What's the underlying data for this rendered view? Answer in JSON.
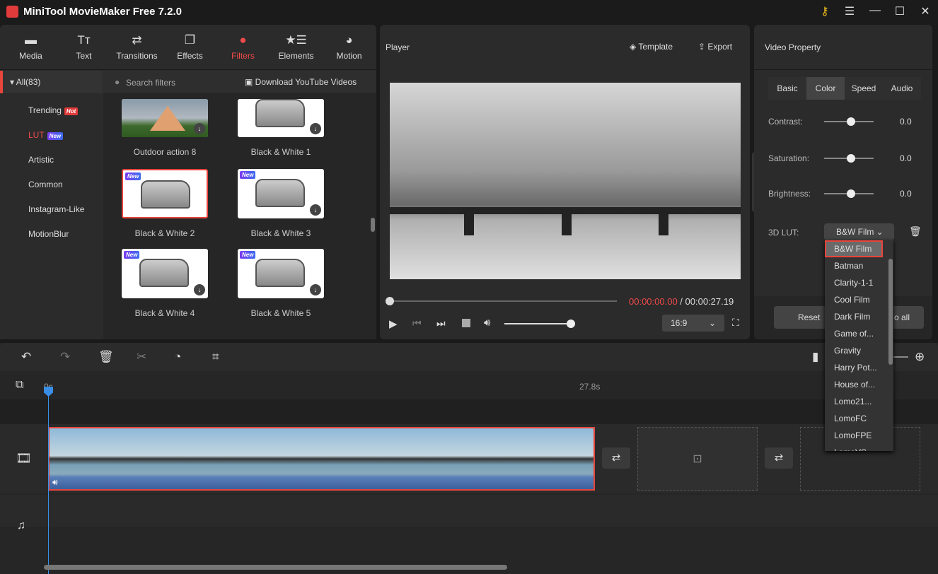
{
  "app": {
    "title": "MiniTool MovieMaker Free 7.2.0"
  },
  "toolbar": [
    {
      "label": "Media",
      "icon": "folder-icon"
    },
    {
      "label": "Text",
      "icon": "text-icon"
    },
    {
      "label": "Transitions",
      "icon": "transitions-icon"
    },
    {
      "label": "Effects",
      "icon": "effects-icon"
    },
    {
      "label": "Filters",
      "icon": "filters-icon"
    },
    {
      "label": "Elements",
      "icon": "elements-icon"
    },
    {
      "label": "Motion",
      "icon": "motion-icon"
    }
  ],
  "sidebar": {
    "all": "All(83)",
    "items": [
      {
        "label": "Trending",
        "badge": "Hot"
      },
      {
        "label": "LUT",
        "badge": "New"
      },
      {
        "label": "Artistic"
      },
      {
        "label": "Common"
      },
      {
        "label": "Instagram-Like"
      },
      {
        "label": "MotionBlur"
      }
    ]
  },
  "search": {
    "placeholder": "Search filters",
    "download": "Download YouTube Videos"
  },
  "filters": [
    {
      "name": "Outdoor action 8"
    },
    {
      "name": "Black & White 1"
    },
    {
      "name": "Black & White 2",
      "badge": "New",
      "selected": true
    },
    {
      "name": "Black & White 3",
      "badge": "New"
    },
    {
      "name": "Black & White 4",
      "badge": "New"
    },
    {
      "name": "Black & White 5",
      "badge": "New"
    }
  ],
  "player": {
    "title": "Player",
    "template": "Template",
    "export": "Export",
    "current_time": "00:00:00.00",
    "separator": " / ",
    "total_time": "00:00:27.19",
    "aspect": "16:9",
    "progress": 0,
    "volume": 1.0
  },
  "property": {
    "title": "Video Property",
    "tabs": [
      "Basic",
      "Color",
      "Speed",
      "Audio"
    ],
    "active_tab": "Color",
    "sliders": [
      {
        "label": "Contrast:",
        "value": "0.0"
      },
      {
        "label": "Saturation:",
        "value": "0.0"
      },
      {
        "label": "Brightness:",
        "value": "0.0"
      }
    ],
    "lut_label": "3D LUT:",
    "lut_value": "B&W Film",
    "reset": "Reset",
    "apply_all": "o all",
    "lut_options": [
      "B&W Film",
      "Batman",
      "Clarity-1-1",
      "Cool Film",
      "Dark Film",
      "Game of...",
      "Gravity",
      "Harry Pot...",
      "House of...",
      "Lomo21...",
      "LomoFC",
      "LomoFPE",
      "LomoVS"
    ]
  },
  "timeline": {
    "ruler": [
      "0s",
      "27.8s"
    ]
  },
  "colors": {
    "accent": "#f04a4a",
    "bg": "#2b2b2b"
  }
}
